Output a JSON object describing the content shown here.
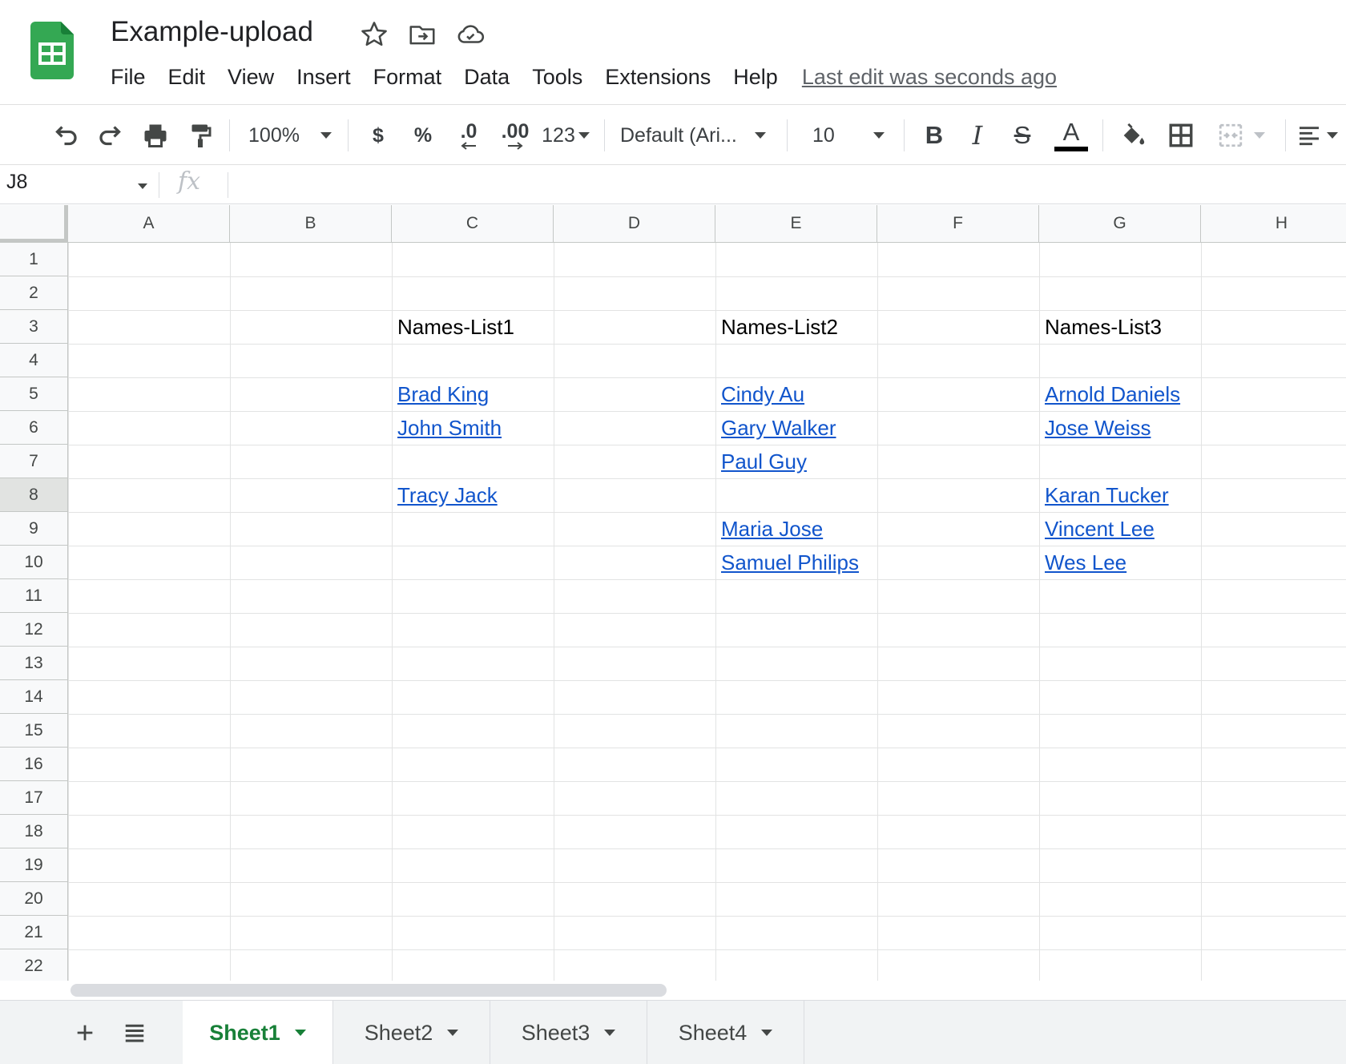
{
  "app": {
    "doc_title": "Example-upload",
    "menus": [
      "File",
      "Edit",
      "View",
      "Insert",
      "Format",
      "Data",
      "Tools",
      "Extensions",
      "Help"
    ],
    "last_edit": "Last edit was seconds ago"
  },
  "toolbar": {
    "zoom": "100%",
    "currency": "$",
    "percent": "%",
    "decrease_decimal": ".0",
    "increase_decimal": ".00",
    "more_formats": "123",
    "font": "Default (Ari...",
    "font_size": "10",
    "bold": "B",
    "italic": "I",
    "strikethrough": "S",
    "text_color_letter": "A",
    "text_color": "#000000"
  },
  "formula_bar": {
    "name_box": "J8",
    "fx": "fx",
    "value": ""
  },
  "grid": {
    "columns": [
      "A",
      "B",
      "C",
      "D",
      "E",
      "F",
      "G",
      "H"
    ],
    "rows": [
      "1",
      "2",
      "3",
      "4",
      "5",
      "6",
      "7",
      "8",
      "9",
      "10",
      "11",
      "12",
      "13",
      "14",
      "15",
      "16",
      "17",
      "18",
      "19",
      "20",
      "21",
      "22"
    ],
    "selected_row": "8",
    "cells": {
      "C3": "Names-List1",
      "E3": "Names-List2",
      "G3": "Names-List3",
      "C5": "Brad King",
      "C6": "John Smith",
      "C8": "Tracy Jack",
      "E5": "Cindy Au",
      "E6": "Gary Walker",
      "E7": "Paul Guy",
      "E9": "Maria Jose",
      "E10": "Samuel Philips",
      "G5": "Arnold Daniels",
      "G6": "Jose Weiss",
      "G8": "Karan Tucker",
      "G9": "Vincent Lee",
      "G10": "Wes Lee"
    },
    "link_color": "#1155cc"
  },
  "sheets": {
    "tabs": [
      "Sheet1",
      "Sheet2",
      "Sheet3",
      "Sheet4"
    ],
    "active": "Sheet1",
    "accent": "#188038"
  }
}
